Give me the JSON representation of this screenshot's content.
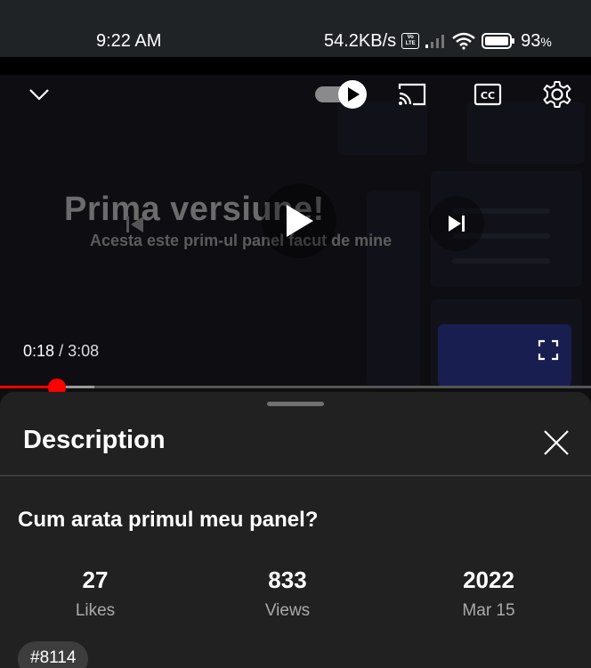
{
  "status_bar": {
    "time": "9:22 AM",
    "speed": "54.2KB/s",
    "volte": "Vo LTE",
    "battery": "93",
    "battery_unit": "%"
  },
  "player": {
    "frame_title": "Prima versiune!",
    "frame_subtitle": "Acesta este prim-ul panel facut de mine",
    "current_time": "0:18",
    "separator": "/",
    "duration": "3:08",
    "progress": 0.097,
    "icons": {
      "minimize": "chevron-down-icon",
      "autoplay": "autoplay-toggle-icon",
      "cast": "cast-icon",
      "captions": "closed-captions-icon",
      "settings": "gear-icon",
      "previous": "skip-previous-icon",
      "play": "play-icon",
      "next": "skip-next-icon",
      "fullscreen": "fullscreen-icon"
    },
    "accent": "#ff0000"
  },
  "description": {
    "header": "Description",
    "title": "Cum arata primul meu panel?",
    "stats": [
      {
        "value": "27",
        "label": "Likes"
      },
      {
        "value": "833",
        "label": "Views"
      },
      {
        "value": "2022",
        "label": "Mar 15"
      }
    ],
    "tag": "#8114"
  }
}
